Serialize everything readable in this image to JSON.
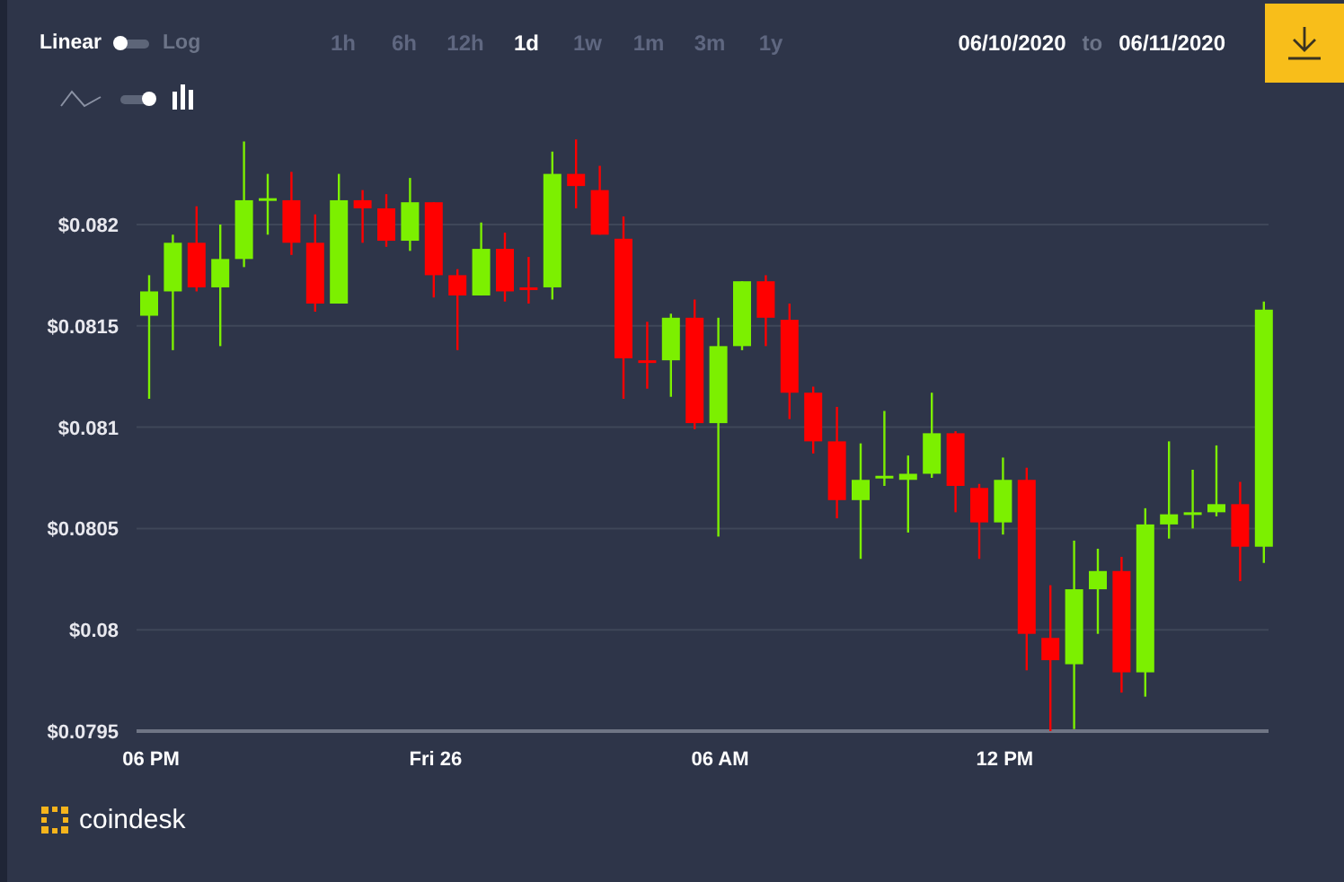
{
  "scale": [
    {
      "label": "Linear",
      "selected": true
    },
    {
      "label": "Log",
      "selected": false
    }
  ],
  "scale_switch": {
    "on": false
  },
  "style_switch": {
    "on": true
  },
  "chart_style": [
    {
      "kind": "line",
      "selected": false
    },
    {
      "kind": "candle",
      "selected": true
    }
  ],
  "ranges": [
    {
      "label": "1h",
      "selected": false
    },
    {
      "label": "6h",
      "selected": false
    },
    {
      "label": "12h",
      "selected": false
    },
    {
      "label": "1d",
      "selected": true
    },
    {
      "label": "1w",
      "selected": false
    },
    {
      "label": "1m",
      "selected": false
    },
    {
      "label": "3m",
      "selected": false
    },
    {
      "label": "1y",
      "selected": false
    }
  ],
  "date_range": {
    "from": "06/10/2020",
    "separator": "to",
    "to": "06/11/2020"
  },
  "chart_data": {
    "type": "candlestick",
    "grid": true,
    "yticks": [
      {
        "value": 0.0795,
        "label": "$0.0795"
      },
      {
        "value": 0.08,
        "label": "$0.08"
      },
      {
        "value": 0.0805,
        "label": "$0.0805"
      },
      {
        "value": 0.081,
        "label": "$0.081"
      },
      {
        "value": 0.0815,
        "label": "$0.0815"
      },
      {
        "value": 0.082,
        "label": "$0.082"
      }
    ],
    "ylim": [
      0.0795,
      0.082
    ],
    "categories": [
      "06 PM",
      null,
      null,
      null,
      null,
      null,
      null,
      null,
      null,
      null,
      null,
      null,
      "Fri 26",
      null,
      null,
      null,
      null,
      null,
      null,
      null,
      null,
      null,
      null,
      null,
      "06 AM",
      null,
      null,
      null,
      null,
      null,
      null,
      null,
      null,
      null,
      null,
      null,
      "12 PM",
      null,
      null,
      null,
      null,
      null,
      null,
      null,
      null,
      null,
      null,
      null
    ],
    "ohlc": [
      [
        0.08155,
        0.08175,
        0.08114,
        0.08167
      ],
      [
        0.08167,
        0.08195,
        0.08138,
        0.08191
      ],
      [
        0.08191,
        0.08209,
        0.08167,
        0.08169
      ],
      [
        0.08169,
        0.082,
        0.0814,
        0.08183
      ],
      [
        0.08183,
        0.08241,
        0.08179,
        0.08212
      ],
      [
        0.08212,
        0.08225,
        0.08195,
        0.08213
      ],
      [
        0.08212,
        0.08226,
        0.08185,
        0.08191
      ],
      [
        0.08191,
        0.08205,
        0.08157,
        0.08161
      ],
      [
        0.08161,
        0.08225,
        0.08161,
        0.08212
      ],
      [
        0.08212,
        0.08217,
        0.08191,
        0.08208
      ],
      [
        0.08208,
        0.08215,
        0.08189,
        0.08192
      ],
      [
        0.08192,
        0.08223,
        0.08187,
        0.08211
      ],
      [
        0.08211,
        0.08211,
        0.08164,
        0.08175
      ],
      [
        0.08175,
        0.08178,
        0.08138,
        0.08165
      ],
      [
        0.08165,
        0.08201,
        0.08165,
        0.08188
      ],
      [
        0.08188,
        0.08196,
        0.08162,
        0.08167
      ],
      [
        0.08169,
        0.08184,
        0.08161,
        0.08168
      ],
      [
        0.08169,
        0.08236,
        0.08163,
        0.08225
      ],
      [
        0.08225,
        0.08242,
        0.08208,
        0.08219
      ],
      [
        0.08217,
        0.08229,
        0.08195,
        0.08195
      ],
      [
        0.08193,
        0.08204,
        0.08114,
        0.08134
      ],
      [
        0.08133,
        0.08152,
        0.08119,
        0.08132
      ],
      [
        0.08133,
        0.08156,
        0.08115,
        0.08154
      ],
      [
        0.08154,
        0.08163,
        0.08099,
        0.08102
      ],
      [
        0.08102,
        0.08154,
        0.08046,
        0.0814
      ],
      [
        0.0814,
        0.08172,
        0.08138,
        0.08172
      ],
      [
        0.08172,
        0.08175,
        0.0814,
        0.08154
      ],
      [
        0.08153,
        0.08161,
        0.08104,
        0.08117
      ],
      [
        0.08117,
        0.0812,
        0.08087,
        0.08093
      ],
      [
        0.08093,
        0.0811,
        0.08055,
        0.08064
      ],
      [
        0.08064,
        0.08092,
        0.08035,
        0.08074
      ],
      [
        0.08075,
        0.08108,
        0.08071,
        0.08076
      ],
      [
        0.08074,
        0.08086,
        0.08048,
        0.08077
      ],
      [
        0.08077,
        0.08117,
        0.08075,
        0.08097
      ],
      [
        0.08097,
        0.08098,
        0.08058,
        0.08071
      ],
      [
        0.0807,
        0.08072,
        0.08035,
        0.08053
      ],
      [
        0.08053,
        0.08085,
        0.08047,
        0.08074
      ],
      [
        0.08074,
        0.0808,
        0.0798,
        0.07998
      ],
      [
        0.07996,
        0.08022,
        0.0795,
        0.07985
      ],
      [
        0.07983,
        0.08044,
        0.07951,
        0.0802
      ],
      [
        0.0802,
        0.0804,
        0.07998,
        0.08029
      ],
      [
        0.08029,
        0.08036,
        0.07969,
        0.07979
      ],
      [
        0.07979,
        0.0806,
        0.07967,
        0.08052
      ],
      [
        0.08052,
        0.08093,
        0.08045,
        0.08057
      ],
      [
        0.08058,
        0.08079,
        0.0805,
        0.08058
      ],
      [
        0.08058,
        0.08091,
        0.08056,
        0.08062
      ],
      [
        0.08062,
        0.08073,
        0.08024,
        0.08041
      ],
      [
        0.08041,
        0.08162,
        0.08033,
        0.08158
      ]
    ]
  },
  "brand": {
    "name": "coindesk"
  }
}
